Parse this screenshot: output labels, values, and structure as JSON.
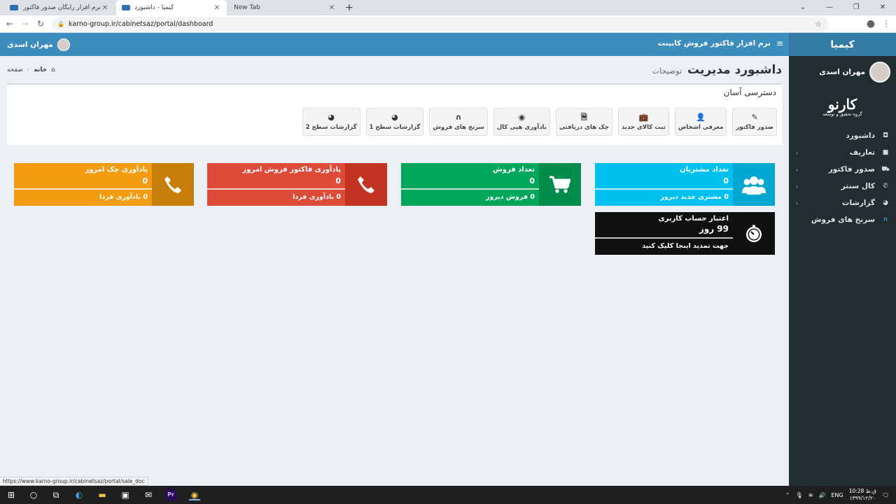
{
  "browser": {
    "tabs": [
      {
        "title": "نرم افزار رایگان صدور فاکتور کابینت",
        "active": false
      },
      {
        "title": "کیمیا - داشبورد",
        "active": true
      },
      {
        "title": "New Tab",
        "active": false
      }
    ],
    "new_tab_symbol": "+",
    "url": "karno-group.ir/cabinetsaz/portal/dashboard",
    "status_url": "https://www.karno-group.ir/cabinetsaz/portal/sale_doc"
  },
  "sidebar": {
    "brand": "کیمیا",
    "user_name": "مهران اسدی",
    "logo_text": "کارنو",
    "logo_subtext": "گروه تحقیق و توسعه",
    "items": [
      {
        "label": "داشبورد",
        "icon": "dashboard-icon",
        "glyph": "◘",
        "has_children": false
      },
      {
        "label": "تعاریف",
        "icon": "bookmark-icon",
        "glyph": "■",
        "has_children": true
      },
      {
        "label": "صدور فاکتور",
        "icon": "cart-icon",
        "glyph": "⛟",
        "has_children": true
      },
      {
        "label": "کال سنتر",
        "icon": "phone-icon",
        "glyph": "✆",
        "has_children": true
      },
      {
        "label": "گزارشات",
        "icon": "pie-chart-icon",
        "glyph": "◕",
        "has_children": true
      },
      {
        "label": "سرنخ های فروش",
        "icon": "magnet-icon",
        "glyph": "∩",
        "has_children": false
      }
    ]
  },
  "topbar": {
    "title": "نرم افزار فاکتور فروش کابینت",
    "user_name": "مهران اسدی"
  },
  "page": {
    "title": "داشبورد مدیریت",
    "subtitle": "توضیحات",
    "breadcrumb_home": "خانه",
    "breadcrumb_current": "صفحه"
  },
  "quick_access": {
    "title": "دسترسی آسان",
    "buttons": [
      {
        "label": "صدور فاکتور",
        "icon": "edit-icon",
        "glyph": "✎"
      },
      {
        "label": "معرفی اشخاص",
        "icon": "user-plus-icon",
        "glyph": "👤"
      },
      {
        "label": "ثبت کالای جدید",
        "icon": "briefcase-icon",
        "glyph": "💼"
      },
      {
        "label": "چک های دریافتی",
        "icon": "file-icon",
        "glyph": "🗎"
      },
      {
        "label": "یادآوری هپی کال",
        "icon": "chrome-icon",
        "glyph": "◉"
      },
      {
        "label": "سرنخ های فروش",
        "icon": "magnet-icon",
        "glyph": "∩"
      },
      {
        "label": "گزارشات سطح 1",
        "icon": "pie-chart-icon",
        "glyph": "◕"
      },
      {
        "label": "گزارشات سطح 2",
        "icon": "pie-chart-icon",
        "glyph": "◕"
      }
    ]
  },
  "info_boxes": [
    {
      "title": "تعداد مشتریان",
      "value": "0",
      "footer": "0 مشتری جدید دیروز",
      "color": "#00c0ef",
      "icon_color": "#00a7d0",
      "icon": "users-icon"
    },
    {
      "title": "تعداد فروش",
      "value": "0",
      "footer": "0 فروش دیروز",
      "color": "#00a65a",
      "icon_color": "#008d4c",
      "icon": "cart-icon"
    },
    {
      "title": "یادآوری فاکتور فروش امروز",
      "value": "0",
      "footer": "0 یادآوری فردا",
      "color": "#dd4b39",
      "icon_color": "#c23321",
      "icon": "phone-icon"
    },
    {
      "title": "یادآوری چک امروز",
      "value": "0",
      "footer": "0 یادآوری فردا",
      "color": "#f39c12",
      "icon_color": "#c87f0a",
      "icon": "phone-icon"
    },
    {
      "title": "اعتبار حساب کاربری",
      "value": "99 روز",
      "footer": "جهت تمدید اینجا کلیک کنید",
      "color": "#111111",
      "icon_color": "#111111",
      "icon": "stopwatch-icon"
    }
  ],
  "taskbar": {
    "lang": "ENG",
    "time": "10:28 ق.ظ",
    "date": "۱۳۹۹/۱۲/۲۰"
  }
}
